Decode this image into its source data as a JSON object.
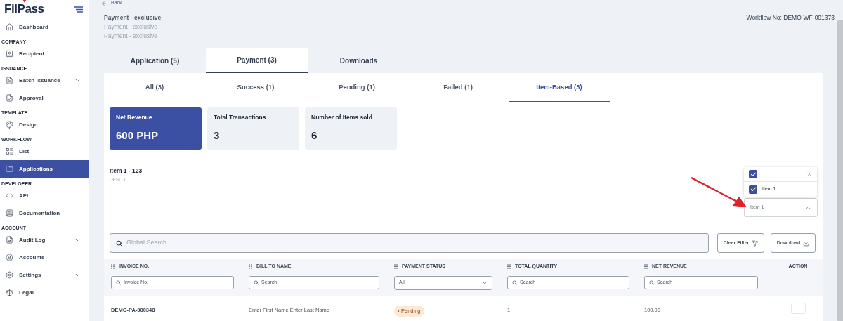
{
  "sidebar": {
    "logo": "FilPass",
    "sections": [
      {
        "items": [
          {
            "label": "Dashboard",
            "expandable": false,
            "selected": false
          }
        ]
      },
      {
        "heading": "COMPANY",
        "items": [
          {
            "label": "Recipient",
            "expandable": false,
            "selected": false
          }
        ]
      },
      {
        "heading": "ISSUANCE",
        "items": [
          {
            "label": "Batch Issuance",
            "expandable": true,
            "selected": false
          },
          {
            "label": "Approval",
            "expandable": false,
            "selected": false
          }
        ]
      },
      {
        "heading": "TEMPLATE",
        "items": [
          {
            "label": "Design",
            "expandable": false,
            "selected": false
          }
        ]
      },
      {
        "heading": "WORKFLOW",
        "items": [
          {
            "label": "List",
            "expandable": false,
            "selected": false
          },
          {
            "label": "Applications",
            "expandable": false,
            "selected": true
          }
        ]
      },
      {
        "heading": "DEVELOPER",
        "items": [
          {
            "label": "API",
            "expandable": false,
            "selected": false
          },
          {
            "label": "Documentation",
            "expandable": false,
            "selected": false
          }
        ]
      },
      {
        "heading": "ACCOUNT",
        "items": [
          {
            "label": "Audit Log",
            "expandable": true,
            "selected": false
          },
          {
            "label": "Accounts",
            "expandable": false,
            "selected": false
          },
          {
            "label": "Settings",
            "expandable": true,
            "selected": false
          },
          {
            "label": "Legal",
            "expandable": false,
            "selected": false
          }
        ]
      }
    ]
  },
  "back": "Back",
  "header": {
    "title": "Payment - exclusive",
    "subtitles": [
      "Payment - exclusive",
      "Payment - exclusive"
    ],
    "workflow_no": "Workflow No: DEMO-WF-001373"
  },
  "tabs": [
    {
      "label": "Application (5)",
      "selected": false
    },
    {
      "label": "Payment (3)",
      "selected": true
    },
    {
      "label": "Downloads",
      "selected": false
    }
  ],
  "subtabs": [
    {
      "label": "All (3)",
      "selected": false
    },
    {
      "label": "Success (1)",
      "selected": false
    },
    {
      "label": "Pending (1)",
      "selected": false
    },
    {
      "label": "Failed (1)",
      "selected": false
    },
    {
      "label": "Item-Based (3)",
      "selected": true
    }
  ],
  "stats": [
    {
      "label": "Net Revenue",
      "value": "600 PHP",
      "highlighted": true
    },
    {
      "label": "Total Transactions",
      "value": "3",
      "highlighted": false
    },
    {
      "label": "Number of Items sold",
      "value": "6",
      "highlighted": false
    }
  ],
  "item": {
    "title": "Item 1 - 123",
    "description": "DESC 1"
  },
  "item_filter": {
    "value": "Item 1",
    "expanded": true,
    "select_all_checked": true,
    "options": [
      {
        "label": "Item 1",
        "checked": true
      }
    ]
  },
  "search": {
    "placeholder": "Global Search"
  },
  "buttons": {
    "clear_filter": "Clear Filter",
    "download": "Download"
  },
  "table": {
    "columns": [
      {
        "label": "INVOICE NO.",
        "kind": "text",
        "placeholder": "Invoice No."
      },
      {
        "label": "BILL TO NAME",
        "kind": "text",
        "placeholder": "Search"
      },
      {
        "label": "PAYMENT STATUS",
        "kind": "select",
        "value": "All"
      },
      {
        "label": "TOTAL QUANTITY",
        "kind": "text",
        "placeholder": "Search"
      },
      {
        "label": "NET REVENUE",
        "kind": "text",
        "placeholder": "Search"
      },
      {
        "label": "ACTION",
        "kind": "plain"
      }
    ],
    "rows": [
      {
        "invoice": "DEMO-PA-000348",
        "bill_to": "Enter First Name Enter Last Name",
        "status": "Pending",
        "quantity": "1",
        "net_revenue": "100.00",
        "action": "···"
      }
    ]
  }
}
